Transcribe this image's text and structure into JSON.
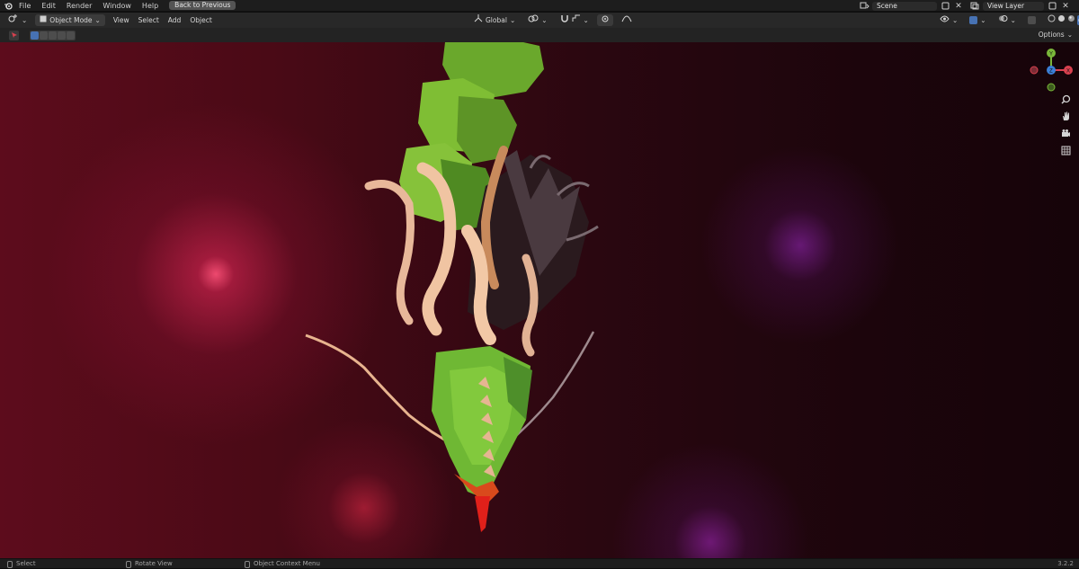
{
  "menu": {
    "items": [
      "File",
      "Edit",
      "Render",
      "Window",
      "Help"
    ],
    "back_button": "Back to Previous"
  },
  "scene": {
    "name": "Scene"
  },
  "view_layer": {
    "name": "View Layer"
  },
  "header": {
    "mode": "Object Mode",
    "menus": [
      "View",
      "Select",
      "Add",
      "Object"
    ],
    "orientation": "Global"
  },
  "toolbar": {
    "options_label": "Options"
  },
  "gizmo": {
    "x_label": "X",
    "y_label": "Y",
    "z_label": "Z"
  },
  "status": {
    "select": "Select",
    "rotate": "Rotate View",
    "context": "Object Context Menu",
    "version": "3.2.2"
  },
  "colors": {
    "x_axis": "#d9414f",
    "y_axis": "#7ab73a",
    "z_axis": "#3b7fd6",
    "active_blue": "#4772b3"
  }
}
